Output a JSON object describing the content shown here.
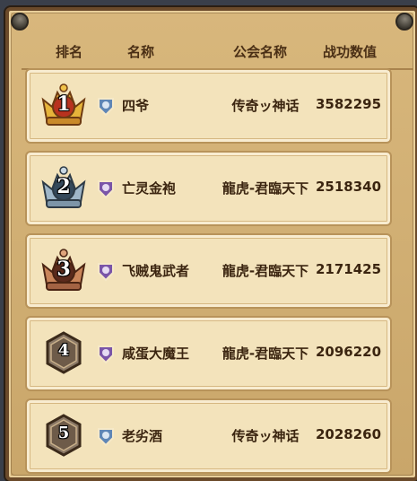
{
  "header": {
    "rank_label": "排名",
    "name_label": "名称",
    "guild_label": "公会名称",
    "power_label": "战功数值"
  },
  "rows": [
    {
      "rank": "1",
      "badge": "gold-crown",
      "class_icon": "mage-class-icon",
      "name": "四爷",
      "guild": "传奇ッ神话",
      "power": "3582295"
    },
    {
      "rank": "2",
      "badge": "silver-crown",
      "class_icon": "necromancer-class-icon",
      "name": "亡灵金袍",
      "guild": "龍虎-君臨天下",
      "power": "2518340"
    },
    {
      "rank": "3",
      "badge": "bronze-crown",
      "class_icon": "necromancer-class-icon",
      "name": "飞贼鬼武者",
      "guild": "龍虎-君臨天下",
      "power": "2171425"
    },
    {
      "rank": "4",
      "badge": "hexagon",
      "class_icon": "necromancer-class-icon",
      "name": "咸蛋大魔王",
      "guild": "龍虎-君臨天下",
      "power": "2096220"
    },
    {
      "rank": "5",
      "badge": "hexagon",
      "class_icon": "mage-class-icon",
      "name": "老劣酒",
      "guild": "传奇ッ神话",
      "power": "2028260"
    }
  ],
  "colors": {
    "gold": "#e6b43a",
    "silver": "#9fb6c8",
    "bronze": "#c9855a",
    "mage": "#5f86b6",
    "necromancer": "#7a55a8"
  }
}
